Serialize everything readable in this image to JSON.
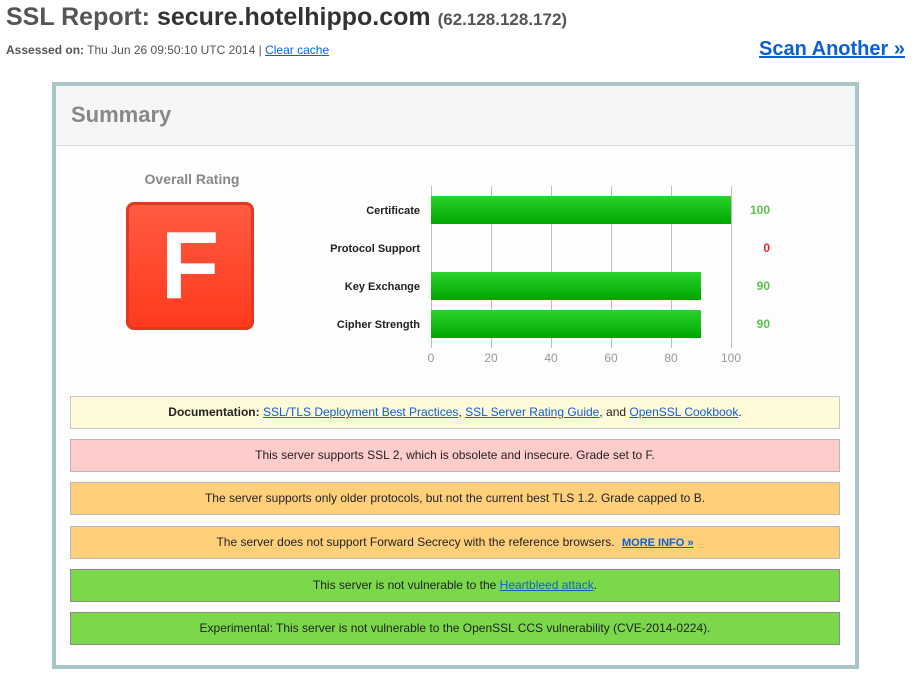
{
  "header": {
    "title_prefix": "SSL Report: ",
    "hostname": "secure.hotelhippo.com",
    "ip": "(62.128.128.172)",
    "assessed_label": "Assessed on:",
    "assessed_value": "Thu Jun 26 09:50:10 UTC 2014",
    "separator": "|",
    "clear_cache_link": "Clear cache",
    "scan_another_link": "Scan Another »"
  },
  "summary": {
    "title": "Summary",
    "overall_rating_label": "Overall Rating",
    "grade": "F",
    "grade_color": "#ff4a2e"
  },
  "chart_data": {
    "type": "bar",
    "orientation": "horizontal",
    "categories": [
      "Certificate",
      "Protocol Support",
      "Key Exchange",
      "Cipher Strength"
    ],
    "values": [
      100,
      0,
      90,
      90
    ],
    "value_colors": [
      "#5cc34a",
      "#e8212b",
      "#5cc34a",
      "#5cc34a"
    ],
    "bar_color": "#1ec31e",
    "xlim": [
      0,
      100
    ],
    "xticks": [
      0,
      20,
      40,
      60,
      80,
      100
    ],
    "grid": true,
    "title": "",
    "xlabel": "",
    "ylabel": ""
  },
  "messages": {
    "documentation": {
      "label": "Documentation:",
      "link1": "SSL/TLS Deployment Best Practices",
      "sep1": ", ",
      "link2": "SSL Server Rating Guide",
      "sep2": ", and ",
      "link3": "OpenSSL Cookbook",
      "end": "."
    },
    "ssl2": "This server supports SSL 2, which is obsolete and insecure. Grade set to F.",
    "protocols": "The server supports only older protocols, but not the current best TLS 1.2. Grade capped to B.",
    "forward_secrecy": {
      "text": "The server does not support Forward Secrecy with the reference browsers.",
      "link": "MORE INFO »"
    },
    "heartbleed": {
      "pre": "This server is not vulnerable to the ",
      "link": "Heartbleed attack",
      "post": "."
    },
    "ccs": "Experimental: This server is not vulnerable to the OpenSSL CCS vulnerability (CVE-2014-0224)."
  }
}
